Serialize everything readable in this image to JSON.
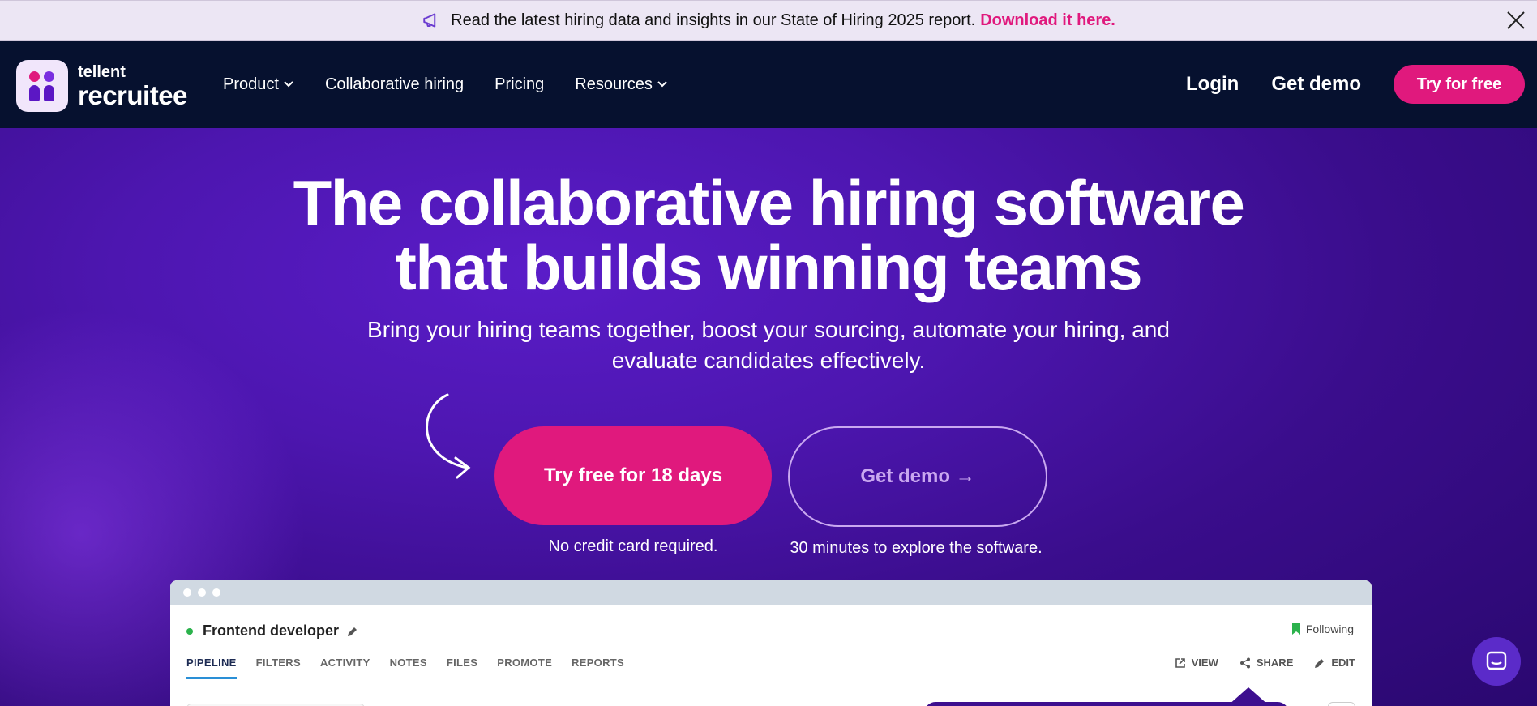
{
  "announcement": {
    "text": "Read the latest hiring data and insights in our State of Hiring 2025 report.",
    "link": "Download it here.",
    "icon": "megaphone-icon"
  },
  "nav": {
    "logo_small": "tellent",
    "logo_big": "recruitee",
    "menu": [
      {
        "label": "Product",
        "dropdown": true
      },
      {
        "label": "Collaborative hiring",
        "dropdown": false
      },
      {
        "label": "Pricing",
        "dropdown": false
      },
      {
        "label": "Resources",
        "dropdown": true
      }
    ],
    "login": "Login",
    "get_demo": "Get demo",
    "try_free": "Try for free"
  },
  "hero": {
    "title_line1": "The collaborative hiring software",
    "title_line2": "that builds winning teams",
    "subtitle_line1": "Bring your hiring teams together, boost your sourcing, automate your hiring, and",
    "subtitle_line2": "evaluate candidates effectively.",
    "cta_primary": "Try free for 18 days",
    "cta_secondary": "Get demo →",
    "note_primary": "No credit card required.",
    "note_secondary": "30 minutes to explore the software."
  },
  "preview": {
    "job_title": "Frontend developer",
    "following": "Following",
    "tabs": [
      "PIPELINE",
      "FILTERS",
      "ACTIVITY",
      "NOTES",
      "FILES",
      "PROMOTE",
      "REPORTS"
    ],
    "active_tab": "PIPELINE",
    "actions": [
      "VIEW",
      "SHARE",
      "EDIT"
    ]
  },
  "colors": {
    "accent": "#e0197d",
    "nav_bg": "#06112f",
    "hero_bg": "#4d16b0",
    "announce_bg": "#ece6f4"
  }
}
